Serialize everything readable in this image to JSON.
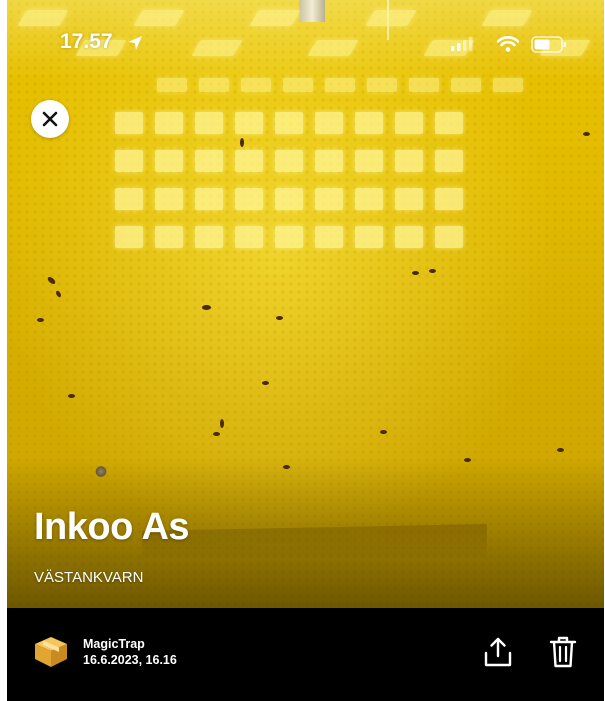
{
  "status_bar": {
    "time": "17.57",
    "icons": [
      "location-arrow-icon",
      "cellular-signal-icon",
      "wifi-icon",
      "battery-icon"
    ]
  },
  "toolbar": {
    "close_icon": "close-icon"
  },
  "photo": {
    "subject": "yellow sticky insect trap board",
    "title": "Inkoo As",
    "subtitle": "VÄSTANKVARN"
  },
  "details": {
    "source_icon": "package-box-icon",
    "source_name": "MagicTrap",
    "date_time": "16.6.2023, 16.16",
    "share_icon": "share-upload-icon",
    "delete_icon": "trash-icon"
  },
  "colors": {
    "trap_yellow": "#e2bb00",
    "bar_background": "#000000",
    "text": "#ffffff",
    "box_icon": "#f0b63a"
  }
}
